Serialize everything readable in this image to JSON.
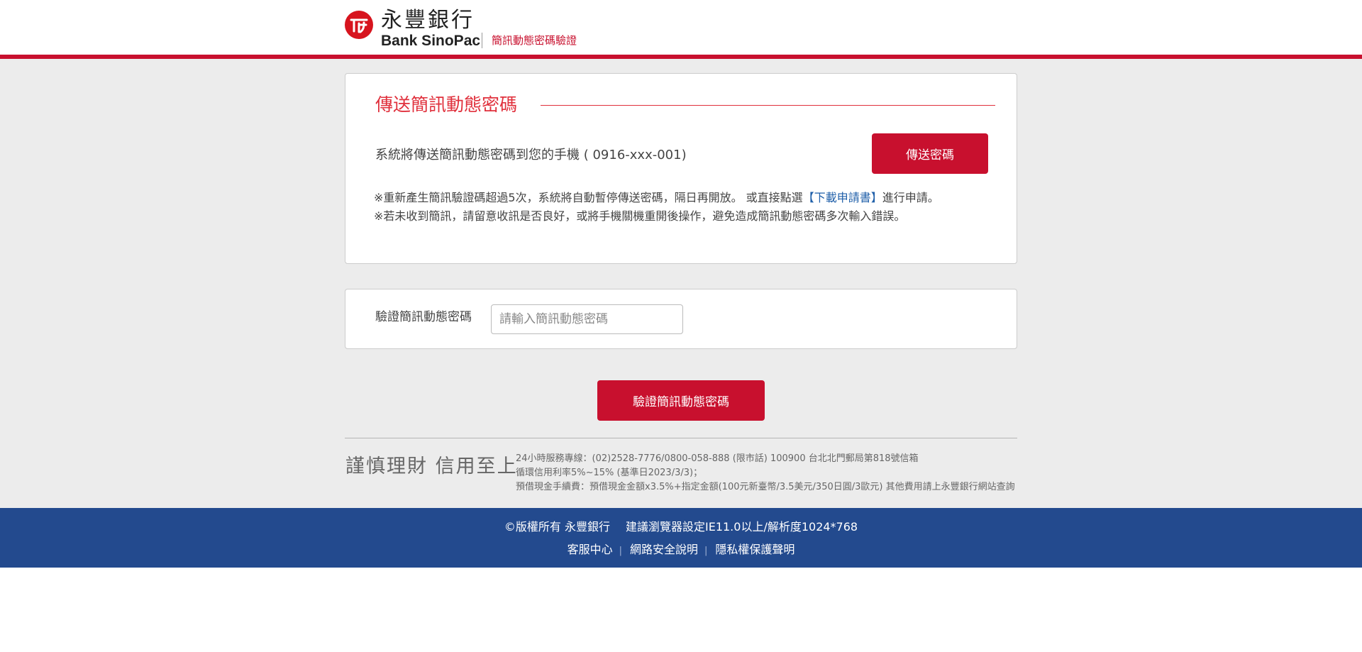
{
  "brand": {
    "name_zh": "永豐銀行",
    "name_en": "Bank SinoPac",
    "subtitle": "簡訊動態密碼驗證",
    "accent_color": "#c8102e",
    "logo_icon": "sinopac-logo-icon"
  },
  "send_section": {
    "title": "傳送簡訊動態密碼",
    "info": "系統將傳送簡訊動態密碼到您的手機 ( 0916-xxx-001)",
    "send_button": "傳送密碼",
    "note1_before": "※重新產生簡訊驗證碼超過5次，系統將自動暫停傳送密碼，隔日再開放。 或直接點選",
    "note1_link": "【下載申請書】",
    "note1_after": "進行申請。",
    "note2": "※若未收到簡訊，請留意收訊是否良好，或將手機關機重開後操作，避免造成簡訊動態密碼多次輸入錯誤。"
  },
  "verify_section": {
    "label": "驗證簡訊動態密碼",
    "input_value": "",
    "input_placeholder": "請輸入簡訊動態密碼",
    "verify_button": "驗證簡訊動態密碼"
  },
  "bottom": {
    "slogan": "謹慎理財 信用至上",
    "contact_line1": "24小時服務專線：(02)2528-7776/0800-058-888 (限市話) 100900 台北北門郵局第818號信箱",
    "contact_line2": "循環信用利率5%~15% (基準日2023/3/3)；",
    "contact_line3": "預借現金手續費：預借現金金額x3.5%+指定金額(100元新臺幣/3.5美元/350日圓/3歐元) 其他費用請上永豐銀行網站查詢"
  },
  "footer": {
    "copyright": "©版權所有 永豐銀行",
    "browser_note": "建議瀏覽器設定IE11.0以上/解析度1024*768",
    "links": [
      "客服中心",
      "網路安全說明",
      "隱私權保護聲明"
    ],
    "background_color": "#234a8e"
  }
}
